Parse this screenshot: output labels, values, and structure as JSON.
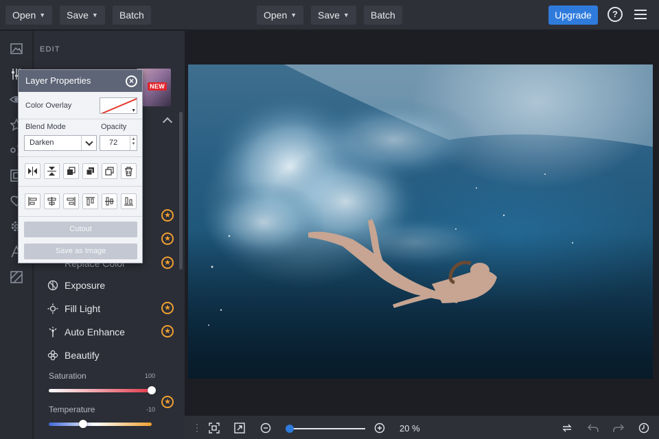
{
  "topbar": {
    "left_group": {
      "open_label": "Open",
      "save_label": "Save",
      "batch_label": "Batch"
    },
    "center_group": {
      "open_label": "Open",
      "save_label": "Save",
      "batch_label": "Batch"
    },
    "upgrade_label": "Upgrade",
    "help_glyph": "?",
    "caret_glyph": "⌄",
    "icons": [
      "help-icon",
      "hamburger-menu-icon"
    ],
    "accent_color": "#2f7bdc"
  },
  "rail": {
    "icons": [
      "image-icon",
      "sliders-icon",
      "eye-icon",
      "star-icon",
      "nodes-icon",
      "frame-icon",
      "heart-icon",
      "gear-icon",
      "text-icon",
      "texture-icon"
    ],
    "collapse_glyph": "«"
  },
  "panel": {
    "title": "EDIT",
    "promo_badge": "NEW",
    "premium_glyph": "★",
    "premium_color": "#f0a030",
    "tools": [
      {
        "label": "Exposure",
        "icon": "exposure-icon",
        "premium": false
      },
      {
        "label": "Fill Light",
        "icon": "sun-icon",
        "premium": true
      },
      {
        "label": "Auto Enhance",
        "icon": "magic-wand-icon",
        "premium": true
      },
      {
        "label": "Beautify",
        "icon": "flower-icon",
        "premium": false
      }
    ],
    "partial_tool_label": "Replace Color",
    "sliders": [
      {
        "label": "Saturation",
        "value": "100",
        "level": 1.0
      },
      {
        "label": "Temperature",
        "value": "-10",
        "level": 0.33
      }
    ]
  },
  "dialog": {
    "title": "Layer Properties",
    "close_glyph": "×",
    "color_overlay_label": "Color Overlay",
    "overlay_color": "#e23a2e",
    "blend_mode_label": "Blend Mode",
    "blend_mode_value": "Darken",
    "opacity_label": "Opacity",
    "opacity_value": "72",
    "transform_icons": [
      "flip-horizontal-icon",
      "flip-vertical-icon",
      "bring-forward-icon",
      "send-backward-icon",
      "duplicate-icon",
      "delete-icon"
    ],
    "align_icons": [
      "align-left-icon",
      "align-center-horizontal-icon",
      "align-right-icon",
      "align-top-icon",
      "align-middle-icon",
      "align-bottom-icon"
    ],
    "cutout_label": "Cutout",
    "save_as_image_label": "Save as Image"
  },
  "canvas": {
    "photo_description_icon": "underwater-photo"
  },
  "bottombar": {
    "icons": [
      "drag-handle-icon",
      "fit-screen-icon",
      "expand-icon",
      "zoom-out-icon",
      "zoom-in-icon",
      "swap-icon",
      "undo-icon",
      "redo-icon",
      "history-icon"
    ],
    "zoom_text": "20 %",
    "zoom_level": 0.2
  }
}
